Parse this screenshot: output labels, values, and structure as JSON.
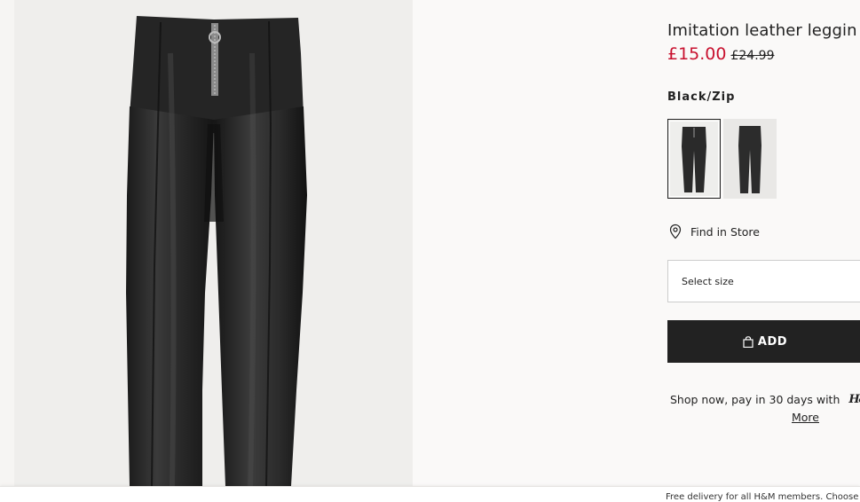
{
  "product": {
    "title": "Imitation leather leggin",
    "price_sale": "£15.00",
    "price_original": "£24.99",
    "color_name": "Black/Zip",
    "swatches": [
      {
        "name": "black-zip",
        "selected": true
      },
      {
        "name": "black",
        "selected": false
      }
    ]
  },
  "actions": {
    "find_in_store": "Find in Store",
    "select_size": "Select size",
    "add_label": "ADD"
  },
  "paylater": {
    "text": "Shop now, pay in 30 days with",
    "logo": "H&M",
    "more_link": "More"
  },
  "footer": {
    "text": "Free delivery for all H&M members. Choose b"
  },
  "colors": {
    "sale_price": "#c8102e",
    "button_bg": "#222222",
    "page_bg": "#faf9f8"
  },
  "icons": [
    "map-pin-icon",
    "shopping-bag-icon"
  ]
}
